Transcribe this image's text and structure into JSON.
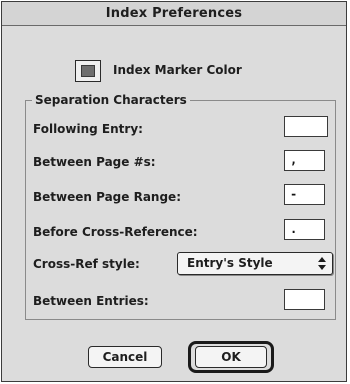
{
  "window": {
    "title": "Index Preferences"
  },
  "marker": {
    "label": "Index Marker Color",
    "swatch_color": "#6f6f6f"
  },
  "separation": {
    "group_title": "Separation Characters",
    "following_entry": {
      "label": "Following Entry:",
      "value": ""
    },
    "between_page_numbers": {
      "label": "Between Page #s:",
      "value": ","
    },
    "between_page_range": {
      "label": "Between Page Range:",
      "value": "-"
    },
    "before_cross_reference": {
      "label": "Before Cross-Reference:",
      "value": "."
    },
    "cross_ref_style": {
      "label": "Cross-Ref style:",
      "selected": "Entry's Style"
    },
    "between_entries": {
      "label": "Between Entries:",
      "value": ""
    }
  },
  "buttons": {
    "cancel": "Cancel",
    "ok": "OK"
  }
}
